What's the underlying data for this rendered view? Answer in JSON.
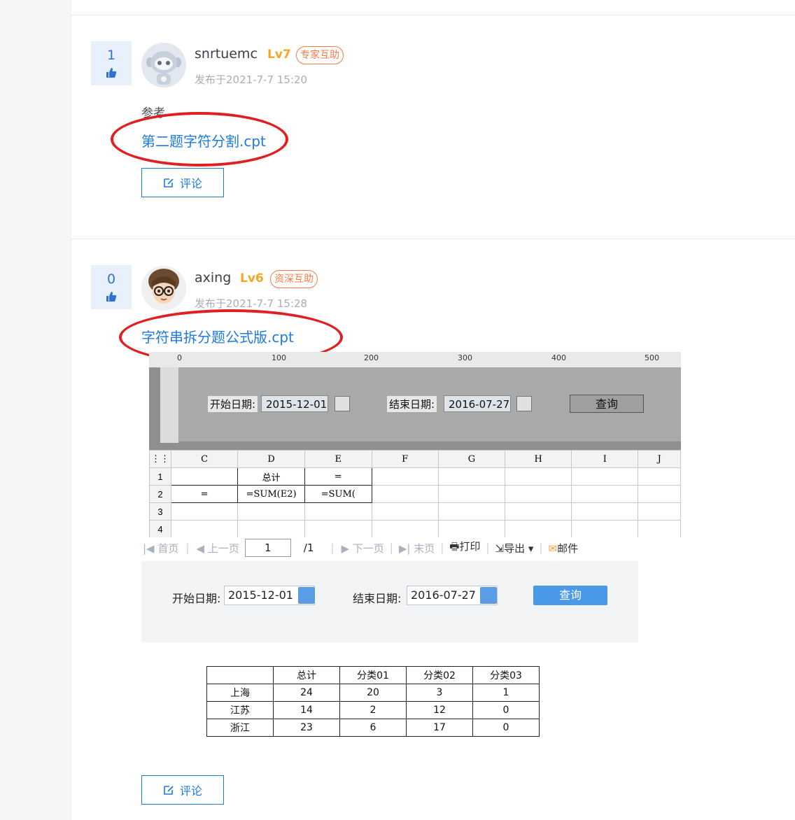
{
  "posts": [
    {
      "votes": "1",
      "username": "snrtuemc",
      "level": "Lv7",
      "badge": "专家互助",
      "post_time": "发布于2021-7-7 15:20",
      "reference": "参考",
      "attachment": "第二题字符分割.cpt",
      "comment_label": "评论"
    },
    {
      "votes": "0",
      "username": "axing",
      "level": "Lv6",
      "badge": "资深互助",
      "post_time": "发布于2021-7-7 15:28",
      "attachment": "字符串拆分题公式版.cpt",
      "comment_label": "评论"
    }
  ],
  "designer": {
    "ruler_ticks": [
      "0",
      "100",
      "200",
      "300",
      "400",
      "500"
    ],
    "start_label": "开始日期:",
    "start_value": "2015-12-01",
    "end_label": "结束日期:",
    "end_value": "2016-07-27",
    "query_label": "查询",
    "columns": [
      "C",
      "D",
      "E",
      "F",
      "G",
      "H",
      "I",
      "J"
    ],
    "rows": [
      "1",
      "2",
      "3",
      "4"
    ],
    "cells": {
      "d1": "总计",
      "e1": "=",
      "c2": "=",
      "d2": "=SUM(E2)",
      "e2": "=SUM("
    }
  },
  "pager": {
    "first": "首页",
    "prev": "上一页",
    "page": "1",
    "total": "/1",
    "next": "下一页",
    "last": "末页",
    "print": "打印",
    "export": "导出",
    "mail": "邮件"
  },
  "preview": {
    "start_label": "开始日期:",
    "start_value": "2015-12-01",
    "end_label": "结束日期:",
    "end_value": "2016-07-27",
    "query_label": "查询"
  },
  "result_table": {
    "headers": [
      "",
      "总计",
      "分类01",
      "分类02",
      "分类03"
    ],
    "rows": [
      [
        "上海",
        "24",
        "20",
        "3",
        "1"
      ],
      [
        "江苏",
        "14",
        "2",
        "12",
        "0"
      ],
      [
        "浙江",
        "23",
        "6",
        "17",
        "0"
      ]
    ]
  },
  "colors": {
    "link": "#1f7ae0",
    "badge": "#ff7a45",
    "level": "#f5a623",
    "highlight": "#e02020"
  }
}
